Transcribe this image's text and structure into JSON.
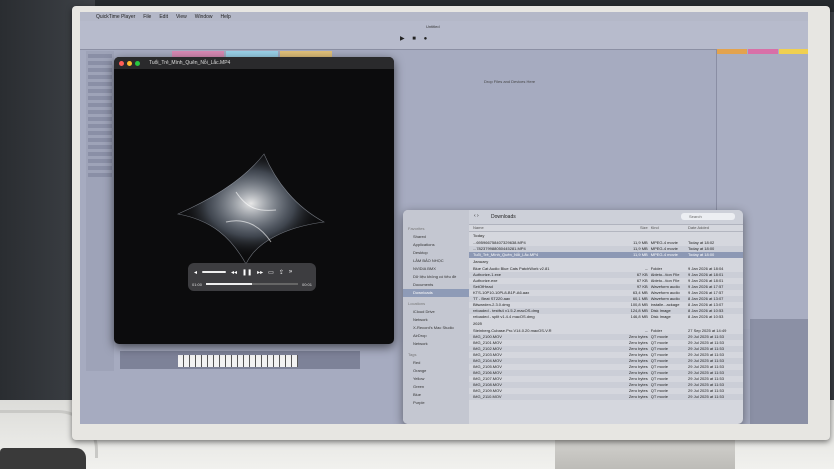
{
  "menubar": {
    "items": [
      "QuickTime Player",
      "File",
      "Edit",
      "View",
      "Window",
      "Help"
    ]
  },
  "daw": {
    "title": "Untitled",
    "center_hint": "Drop Files and Devices Here"
  },
  "video": {
    "window_title": "Tuổi_Trẻ_Mình_Quên_Nỗi_Lắc.MP4",
    "time_elapsed": "01:00",
    "time_remaining": "00:01",
    "progress": 0.5
  },
  "finder": {
    "location": "Downloads",
    "search_placeholder": "Search",
    "sidebar": {
      "favorites_header": "Favorites",
      "favorites": [
        "Shared",
        "Applications",
        "Desktop",
        "LÂM BẢO NHỌC",
        "NVIDIA BMX",
        "Dữ liệu không có tiêu đề",
        "Documents",
        "Downloads"
      ],
      "locations_header": "Locations",
      "locations": [
        "iCloud Drive",
        "Network",
        "X-Record's Mac Studio",
        "AirDrop",
        "Network"
      ],
      "tags_header": "Tags",
      "tags": [
        "Red",
        "Orange",
        "Yellow",
        "Green",
        "Blue",
        "Purple"
      ]
    },
    "columns": [
      "Name",
      "Size",
      "Kind",
      "Date Added"
    ],
    "today_label": "Today",
    "files_today": [
      {
        "name": "...695966758407329638.MP4",
        "size": "11,9 MB",
        "kind": "MPEG-4 movie",
        "date": "Today at 18:02"
      },
      {
        "name": "...782379988050445281.MP4",
        "size": "11,9 MB",
        "kind": "MPEG-4 movie",
        "date": "Today at 18:00"
      },
      {
        "name": "Tuổi_Trẻ_Mình_Quên_Nỗi_Lắc.MP4",
        "size": "11,9 MB",
        "kind": "MPEG-4 movie",
        "date": "Today at 18:00"
      }
    ],
    "jan_label": "January",
    "files_jan": [
      {
        "name": "Blue Cat Audio Blue Cats PatchWork v2.81",
        "size": "--",
        "kind": "Folder",
        "date": "9 Jan 2026 at 18:04"
      },
      {
        "name": "Authorize-1.exe",
        "size": "67 KB",
        "kind": "Ableto...tion File",
        "date": "9 Jan 2026 at 18:01"
      },
      {
        "name": "Authorize.exe",
        "size": "67 KB",
        "kind": "Ableto...tion File",
        "date": "9 Jan 2026 at 18:01"
      },
      {
        "name": "SetOfHead",
        "size": "97 KB",
        "kind": "Waveform audio",
        "date": "9 Jan 2026 at 17:57"
      },
      {
        "name": "KTS-10P10-10PL8-B1P-A6.aax",
        "size": "63,4 MB",
        "kind": "Waveform audio",
        "date": "9 Jan 2026 at 17:57"
      },
      {
        "name": "TT - Beat ST220.aax",
        "size": "60,1 MB",
        "kind": "Waveform audio",
        "date": "8 Jan 2026 at 13:07"
      },
      {
        "name": "Bitwarden-2.3.0.dmg",
        "size": "100,8 MB",
        "kind": "installe...ackage",
        "date": "8 Jan 2026 at 13:07"
      },
      {
        "name": "reloaded - testfs4 v1.5.2.macOS.dmg",
        "size": "124,8 MB",
        "kind": "Disk Image",
        "date": "8 Jan 2026 at 10:53"
      },
      {
        "name": "reloaded - split v1.4.4 macOS.dmg",
        "size": "146,8 MB",
        "kind": "Disk Image",
        "date": "8 Jan 2026 at 10:53"
      }
    ],
    "y2025_label": "2025",
    "files_2025": [
      {
        "name": "Steinberg.Cubase.Pro.V14.0.20.macOS-V.R",
        "size": "--",
        "kind": "Folder",
        "date": "27 Sep 2025 at 14:49"
      },
      {
        "name": "IMG_2100.MOV",
        "size": "Zero bytes",
        "kind": "QT movie",
        "date": "29 Jul 2025 at 11:53"
      },
      {
        "name": "IMG_2101.MOV",
        "size": "Zero bytes",
        "kind": "QT movie",
        "date": "29 Jul 2025 at 11:53"
      },
      {
        "name": "IMG_2102.MOV",
        "size": "Zero bytes",
        "kind": "QT movie",
        "date": "29 Jul 2025 at 11:53"
      },
      {
        "name": "IMG_2103.MOV",
        "size": "Zero bytes",
        "kind": "QT movie",
        "date": "29 Jul 2025 at 11:53"
      },
      {
        "name": "IMG_2104.MOV",
        "size": "Zero bytes",
        "kind": "QT movie",
        "date": "29 Jul 2025 at 11:53"
      },
      {
        "name": "IMG_2105.MOV",
        "size": "Zero bytes",
        "kind": "QT movie",
        "date": "29 Jul 2025 at 11:53"
      },
      {
        "name": "IMG_2106.MOV",
        "size": "Zero bytes",
        "kind": "QT movie",
        "date": "29 Jul 2025 at 11:53"
      },
      {
        "name": "IMG_2107.MOV",
        "size": "Zero bytes",
        "kind": "QT movie",
        "date": "29 Jul 2025 at 11:53"
      },
      {
        "name": "IMG_2108.MOV",
        "size": "Zero bytes",
        "kind": "QT movie",
        "date": "29 Jul 2025 at 11:53"
      },
      {
        "name": "IMG_2109.MOV",
        "size": "Zero bytes",
        "kind": "QT movie",
        "date": "29 Jul 2025 at 11:53"
      },
      {
        "name": "IMG_2110.MOV",
        "size": "Zero bytes",
        "kind": "QT movie",
        "date": "29 Jul 2025 at 11:53"
      }
    ]
  },
  "colors": {
    "selection": "#8c98b4",
    "daw_bg": "#a6abc0",
    "video_bg": "#0c0c0d"
  }
}
